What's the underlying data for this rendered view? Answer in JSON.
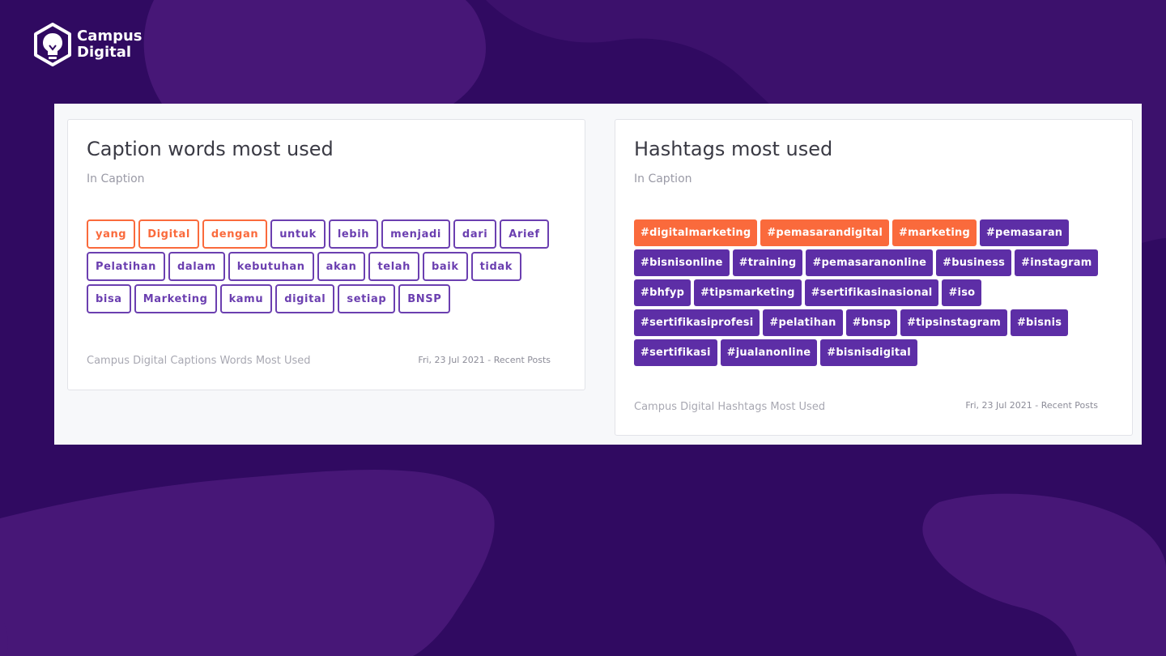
{
  "brand": {
    "line1": "Campus",
    "line2": "Digital",
    "icon": "lightbulb-hexagon-icon",
    "colors": {
      "background": "#300a61",
      "blob": "#471777",
      "accent": "#fa6a3c",
      "purple": "#5d2ea6"
    }
  },
  "caption_card": {
    "title": "Caption words most used",
    "subtitle": "In Caption",
    "tags": [
      {
        "label": "yang",
        "highlight": true
      },
      {
        "label": "Digital",
        "highlight": true
      },
      {
        "label": "dengan",
        "highlight": true
      },
      {
        "label": "untuk",
        "highlight": false
      },
      {
        "label": "lebih",
        "highlight": false
      },
      {
        "label": "menjadi",
        "highlight": false
      },
      {
        "label": "dari",
        "highlight": false
      },
      {
        "label": "Arief",
        "highlight": false
      },
      {
        "label": "Pelatihan",
        "highlight": false
      },
      {
        "label": "dalam",
        "highlight": false
      },
      {
        "label": "kebutuhan",
        "highlight": false
      },
      {
        "label": "akan",
        "highlight": false
      },
      {
        "label": "telah",
        "highlight": false
      },
      {
        "label": "baik",
        "highlight": false
      },
      {
        "label": "tidak",
        "highlight": false
      },
      {
        "label": "bisa",
        "highlight": false
      },
      {
        "label": "Marketing",
        "highlight": false
      },
      {
        "label": "kamu",
        "highlight": false
      },
      {
        "label": "digital",
        "highlight": false
      },
      {
        "label": "setiap",
        "highlight": false
      },
      {
        "label": "BNSP",
        "highlight": false
      }
    ],
    "footer_left": "Campus Digital Captions Words Most Used",
    "footer_right": "Fri, 23 Jul 2021 - Recent Posts"
  },
  "hashtag_card": {
    "title": "Hashtags most used",
    "subtitle": "In Caption",
    "tags": [
      {
        "label": "#digitalmarketing",
        "highlight": true
      },
      {
        "label": "#pemasarandigital",
        "highlight": true
      },
      {
        "label": "#marketing",
        "highlight": true
      },
      {
        "label": "#pemasaran",
        "highlight": false
      },
      {
        "label": "#bisnisonline",
        "highlight": false
      },
      {
        "label": "#training",
        "highlight": false
      },
      {
        "label": "#pemasaranonline",
        "highlight": false
      },
      {
        "label": "#business",
        "highlight": false
      },
      {
        "label": "#instagram",
        "highlight": false
      },
      {
        "label": "#bhfyp",
        "highlight": false
      },
      {
        "label": "#tipsmarketing",
        "highlight": false
      },
      {
        "label": "#sertifikasinasional",
        "highlight": false
      },
      {
        "label": "#iso",
        "highlight": false
      },
      {
        "label": "#sertifikasiprofesi",
        "highlight": false
      },
      {
        "label": "#pelatihan",
        "highlight": false
      },
      {
        "label": "#bnsp",
        "highlight": false
      },
      {
        "label": "#tipsinstagram",
        "highlight": false
      },
      {
        "label": "#bisnis",
        "highlight": false
      },
      {
        "label": "#sertifikasi",
        "highlight": false
      },
      {
        "label": "#jualanonline",
        "highlight": false
      },
      {
        "label": "#bisnisdigital",
        "highlight": false
      }
    ],
    "footer_left": "Campus Digital Hashtags Most Used",
    "footer_right": "Fri, 23 Jul 2021 - Recent Posts"
  }
}
